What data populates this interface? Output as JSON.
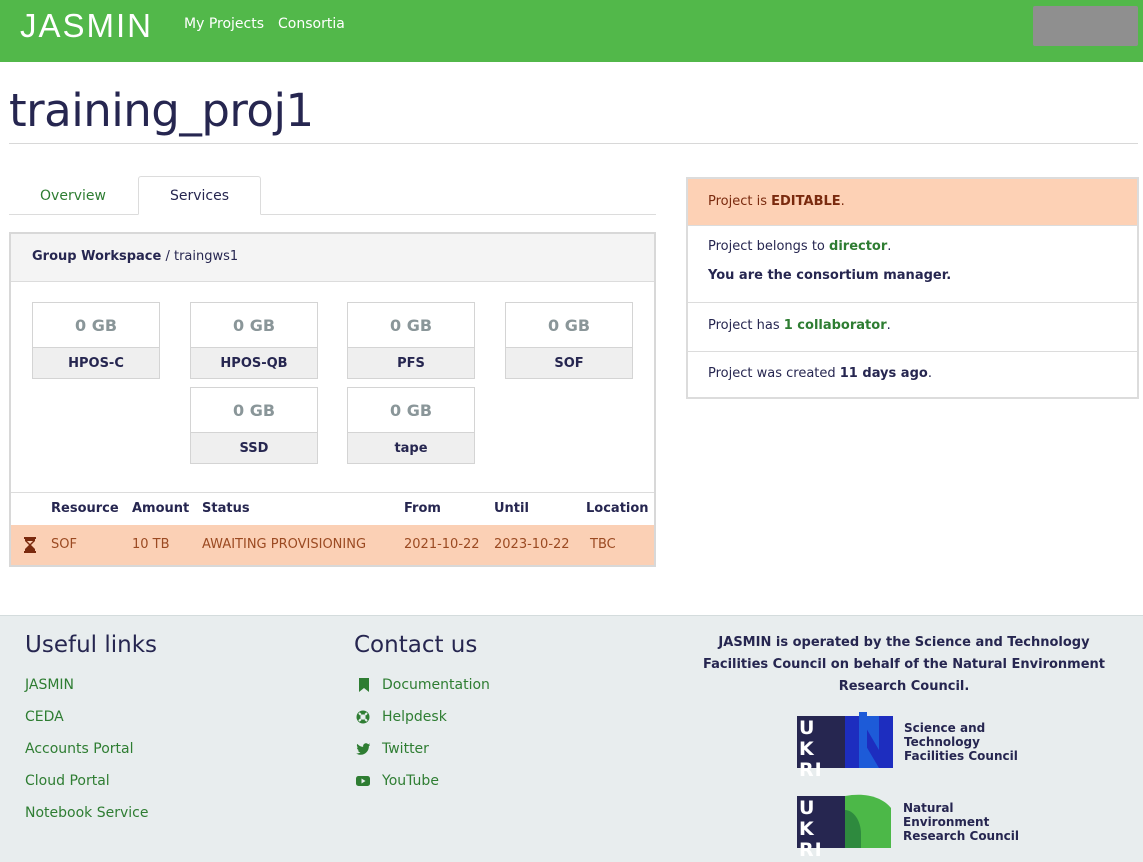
{
  "navbar": {
    "brand": "JASMIN",
    "links": [
      "My Projects",
      "Consortia"
    ]
  },
  "page": {
    "title": "training_proj1"
  },
  "tabs": [
    {
      "label": "Overview",
      "active": false
    },
    {
      "label": "Services",
      "active": true
    }
  ],
  "service": {
    "kind": "Group Workspace",
    "separator": " / ",
    "name": "traingws1",
    "quotas": [
      {
        "value": "0 GB",
        "name": "HPOS-C"
      },
      {
        "value": "0 GB",
        "name": "HPOS-QB"
      },
      {
        "value": "0 GB",
        "name": "PFS"
      },
      {
        "value": "0 GB",
        "name": "SOF"
      },
      {
        "value": "0 GB",
        "name": "SSD"
      },
      {
        "value": "0 GB",
        "name": "tape"
      }
    ],
    "table": {
      "headers": [
        "Resource",
        "Amount",
        "Status",
        "From",
        "Until",
        "Location"
      ],
      "rows": [
        {
          "icon": "hourglass-icon",
          "resource": "SOF",
          "amount": "10 TB",
          "status": "AWAITING PROVISIONING",
          "from": "2021-10-22",
          "until": "2023-10-22",
          "location": "TBC"
        }
      ]
    }
  },
  "status": {
    "editable_prefix": "Project is ",
    "editable_value": "EDITABLE",
    "editable_suffix": ".",
    "belongs_prefix": "Project belongs to ",
    "belongs_value": "director",
    "belongs_suffix": ".",
    "manager_note": "You are the consortium manager.",
    "collab_prefix": "Project has ",
    "collab_value": "1 collaborator",
    "collab_suffix": ".",
    "created_prefix": "Project was created ",
    "created_value": "11 days ago",
    "created_suffix": "."
  },
  "footer": {
    "useful_links_title": "Useful links",
    "useful_links": [
      "JASMIN",
      "CEDA",
      "Accounts Portal",
      "Cloud Portal",
      "Notebook Service"
    ],
    "contact_title": "Contact us",
    "contact_links": [
      {
        "label": "Documentation",
        "icon": "bookmark-icon"
      },
      {
        "label": "Helpdesk",
        "icon": "lifebuoy-icon"
      },
      {
        "label": "Twitter",
        "icon": "twitter-icon"
      },
      {
        "label": "YouTube",
        "icon": "youtube-icon"
      }
    ],
    "operated_text": "JASMIN is operated by the Science and Technology Facilities Council on behalf of the Natural Environment Research Council.",
    "logos": [
      {
        "letters": "UKRI",
        "line1": "Science and",
        "line2": "Technology",
        "line3": "Facilities Council"
      },
      {
        "letters": "UKRI",
        "line1": "Natural",
        "line2": "Environment",
        "line3": "Research Council"
      }
    ]
  },
  "colors": {
    "navbar": "#52b84a",
    "link_green": "#2e7d32",
    "warning_bg": "#fbd0b5",
    "navy": "#262650"
  }
}
